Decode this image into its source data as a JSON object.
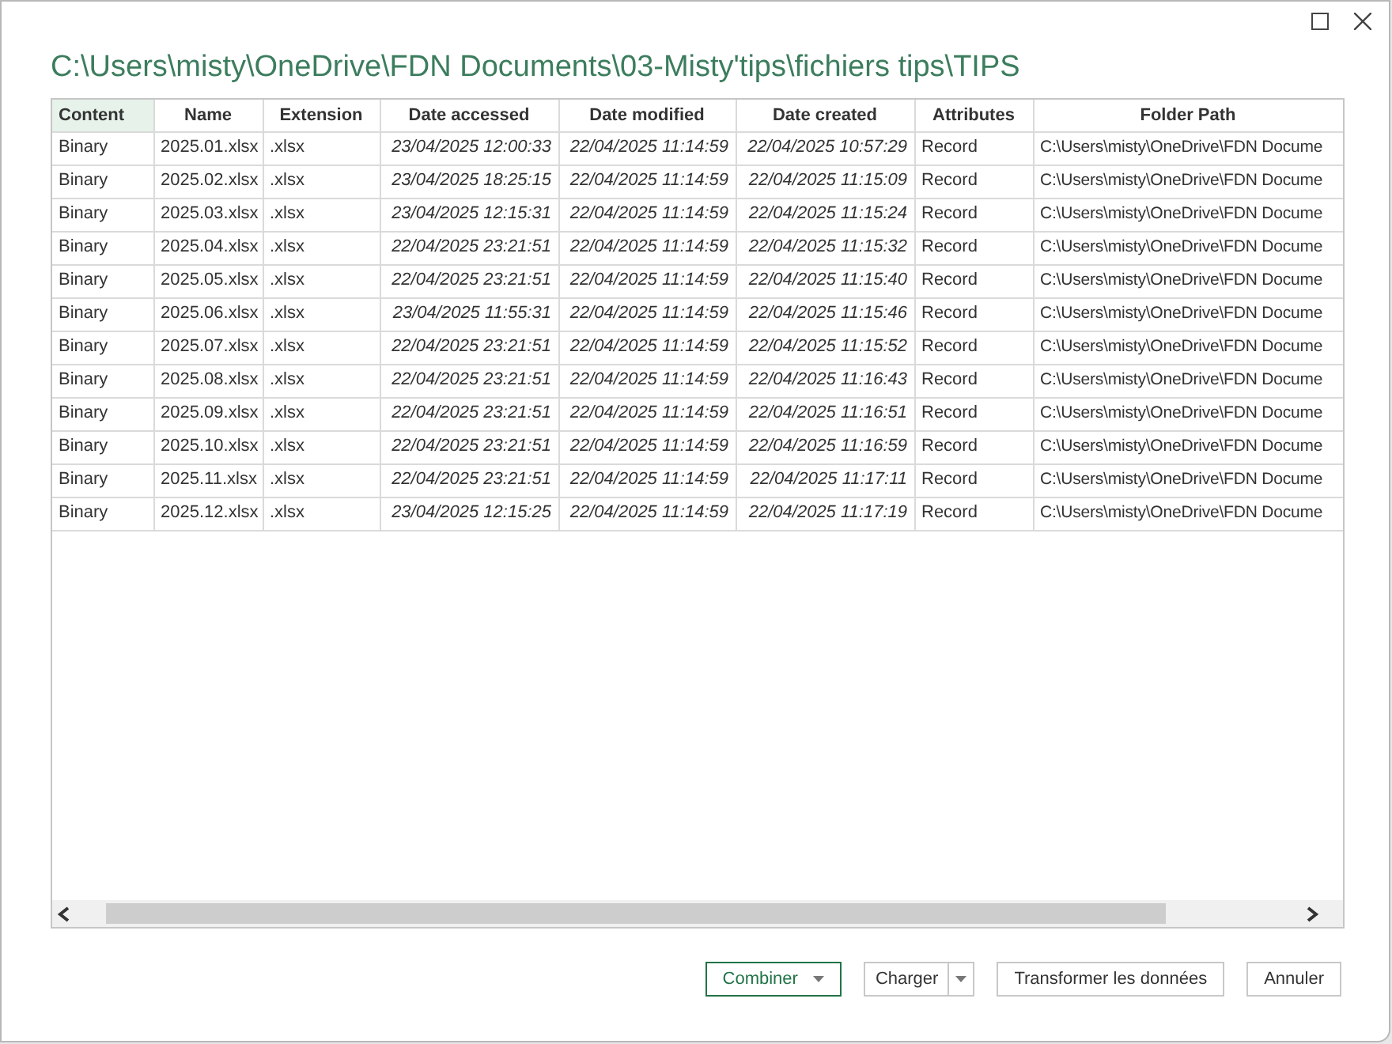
{
  "window": {
    "title": "C:\\Users\\misty\\OneDrive\\FDN Documents\\03-Misty'tips\\fichiers tips\\TIPS"
  },
  "table": {
    "columns": [
      {
        "label": "Content",
        "kind": "text",
        "selected": true
      },
      {
        "label": "Name",
        "kind": "text",
        "selected": false
      },
      {
        "label": "Extension",
        "kind": "text",
        "selected": false
      },
      {
        "label": "Date accessed",
        "kind": "date",
        "selected": false
      },
      {
        "label": "Date modified",
        "kind": "date",
        "selected": false
      },
      {
        "label": "Date created",
        "kind": "date",
        "selected": false
      },
      {
        "label": "Attributes",
        "kind": "text",
        "selected": false
      },
      {
        "label": "Folder Path",
        "kind": "text",
        "selected": false
      }
    ],
    "rows": [
      [
        "Binary",
        "2025.01.xlsx",
        ".xlsx",
        "23/04/2025 12:00:33",
        "22/04/2025 11:14:59",
        "22/04/2025 10:57:29",
        "Record",
        "C:\\Users\\misty\\OneDrive\\FDN Docume"
      ],
      [
        "Binary",
        "2025.02.xlsx",
        ".xlsx",
        "23/04/2025 18:25:15",
        "22/04/2025 11:14:59",
        "22/04/2025 11:15:09",
        "Record",
        "C:\\Users\\misty\\OneDrive\\FDN Docume"
      ],
      [
        "Binary",
        "2025.03.xlsx",
        ".xlsx",
        "23/04/2025 12:15:31",
        "22/04/2025 11:14:59",
        "22/04/2025 11:15:24",
        "Record",
        "C:\\Users\\misty\\OneDrive\\FDN Docume"
      ],
      [
        "Binary",
        "2025.04.xlsx",
        ".xlsx",
        "22/04/2025 23:21:51",
        "22/04/2025 11:14:59",
        "22/04/2025 11:15:32",
        "Record",
        "C:\\Users\\misty\\OneDrive\\FDN Docume"
      ],
      [
        "Binary",
        "2025.05.xlsx",
        ".xlsx",
        "22/04/2025 23:21:51",
        "22/04/2025 11:14:59",
        "22/04/2025 11:15:40",
        "Record",
        "C:\\Users\\misty\\OneDrive\\FDN Docume"
      ],
      [
        "Binary",
        "2025.06.xlsx",
        ".xlsx",
        "23/04/2025 11:55:31",
        "22/04/2025 11:14:59",
        "22/04/2025 11:15:46",
        "Record",
        "C:\\Users\\misty\\OneDrive\\FDN Docume"
      ],
      [
        "Binary",
        "2025.07.xlsx",
        ".xlsx",
        "22/04/2025 23:21:51",
        "22/04/2025 11:14:59",
        "22/04/2025 11:15:52",
        "Record",
        "C:\\Users\\misty\\OneDrive\\FDN Docume"
      ],
      [
        "Binary",
        "2025.08.xlsx",
        ".xlsx",
        "22/04/2025 23:21:51",
        "22/04/2025 11:14:59",
        "22/04/2025 11:16:43",
        "Record",
        "C:\\Users\\misty\\OneDrive\\FDN Docume"
      ],
      [
        "Binary",
        "2025.09.xlsx",
        ".xlsx",
        "22/04/2025 23:21:51",
        "22/04/2025 11:14:59",
        "22/04/2025 11:16:51",
        "Record",
        "C:\\Users\\misty\\OneDrive\\FDN Docume"
      ],
      [
        "Binary",
        "2025.10.xlsx",
        ".xlsx",
        "22/04/2025 23:21:51",
        "22/04/2025 11:14:59",
        "22/04/2025 11:16:59",
        "Record",
        "C:\\Users\\misty\\OneDrive\\FDN Docume"
      ],
      [
        "Binary",
        "2025.11.xlsx",
        ".xlsx",
        "22/04/2025 23:21:51",
        "22/04/2025 11:14:59",
        "22/04/2025 11:17:11",
        "Record",
        "C:\\Users\\misty\\OneDrive\\FDN Docume"
      ],
      [
        "Binary",
        "2025.12.xlsx",
        ".xlsx",
        "23/04/2025 12:15:25",
        "22/04/2025 11:14:59",
        "22/04/2025 11:17:19",
        "Record",
        "C:\\Users\\misty\\OneDrive\\FDN Docume"
      ]
    ]
  },
  "buttons": [
    {
      "label": "Combiner",
      "kind": "dropdown",
      "primary": true
    },
    {
      "label": "Charger",
      "kind": "split",
      "primary": false
    },
    {
      "label": "Transformer les données",
      "kind": "plain",
      "primary": false
    },
    {
      "label": "Annuler",
      "kind": "plain",
      "primary": false
    }
  ]
}
